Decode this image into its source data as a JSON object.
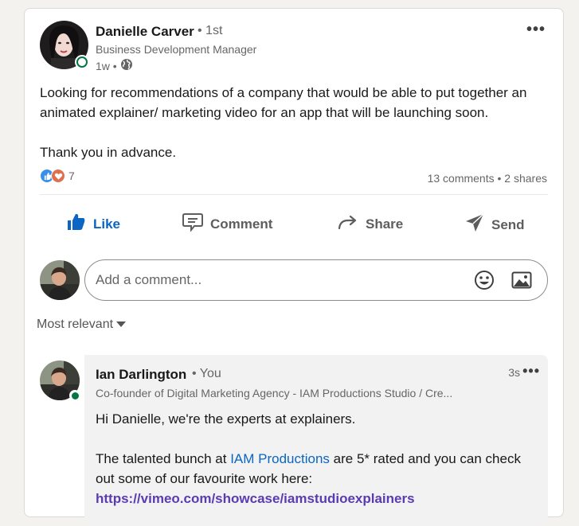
{
  "post": {
    "author": {
      "name": "Danielle Carver",
      "degree": "• 1st",
      "headline": "Business Development Manager",
      "time": "1w •",
      "visibility_icon": "globe-icon",
      "online": true
    },
    "text": {
      "paragraph1": "Looking for recommendations of a company that would be able to put together an animated explainer/ marketing video for an app that will be launching soon.",
      "paragraph2": "Thank you in advance."
    },
    "reactions": {
      "icons": [
        "like-reaction-icon",
        "love-reaction-icon"
      ],
      "count": "7"
    },
    "social_counts": "13 comments • 2 shares",
    "more_label": "•••"
  },
  "actions": {
    "like": "Like",
    "comment": "Comment",
    "share": "Share",
    "send": "Send"
  },
  "comment_box": {
    "placeholder": "Add a comment...",
    "emoji_icon": "emoji-icon",
    "image_icon": "image-icon"
  },
  "sort": {
    "label": "Most relevant"
  },
  "comments": [
    {
      "author": "Ian Darlington",
      "relation": "• You",
      "time": "3s",
      "more_label": "•••",
      "headline": "Co-founder of Digital Marketing Agency - IAM Productions Studio / Cre...",
      "greeting": "Hi Danielle, we're the experts at explainers.",
      "body_pre": "The talented bunch at ",
      "mention": "IAM Productions",
      "body_post": " are 5* rated and you can check out some of our favourite work here:",
      "link": "https://vimeo.com/showcase/iamstudioexplainers"
    }
  ],
  "colors": {
    "accent": "#0a66c2",
    "online": "#057642",
    "link": "#5b3bb1"
  }
}
